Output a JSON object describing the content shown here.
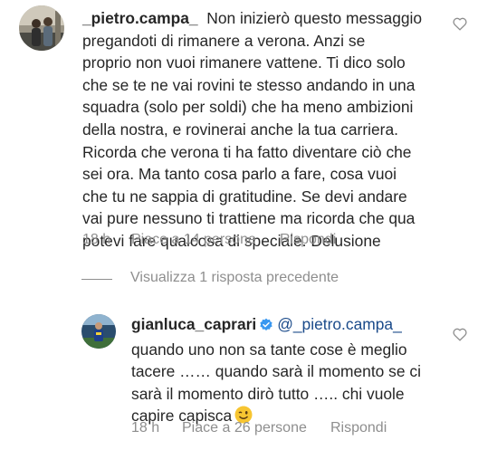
{
  "comment1": {
    "username": "_pietro.campa_",
    "text_lines": [
      "Non inizierò questo messaggio",
      "pregandoti di rimanere a verona. Anzi se",
      "proprio non vuoi rimanere vattene. Ti dico solo",
      "che se te ne vai rovini te stesso andando in una",
      "squadra (solo per soldi) che ha meno ambizioni",
      "della nostra, e rovinerai anche la tua carriera.",
      "Ricorda che verona ti ha fatto diventare ciò che",
      "sei ora. Ma tanto cosa parlo a fare, cosa vuoi",
      "che tu ne sappia di gratitudine. Se devi andare",
      "vai pure nessuno ti trattiene ma ricorda che qua",
      "potevi fare qualcosa di speciale. Delusione"
    ],
    "time": "18 h",
    "likes": "Piace a 14 persone",
    "reply": "Rispondi",
    "like_icon": "heart-outline-icon"
  },
  "view_replies": "Visualizza 1 risposta precedente",
  "comment2": {
    "username": "gianluca_caprari",
    "verified_icon": "verified-badge-icon",
    "mention": "@_pietro.campa_",
    "text_lines": [
      "quando uno non sa tante cose è meglio",
      "tacere …… quando sarà il momento se ci",
      "sarà il momento dirò tutto ….. chi vuole",
      "capire capisca"
    ],
    "emoji": "winking-face-emoji",
    "time": "18 h",
    "likes": "Piace a 26 persone",
    "reply": "Rispondi",
    "like_icon": "heart-outline-icon"
  },
  "colors": {
    "text": "#262626",
    "secondary": "#8e8e8e",
    "mention": "#1a4a8a",
    "verified": "#3897f0"
  }
}
